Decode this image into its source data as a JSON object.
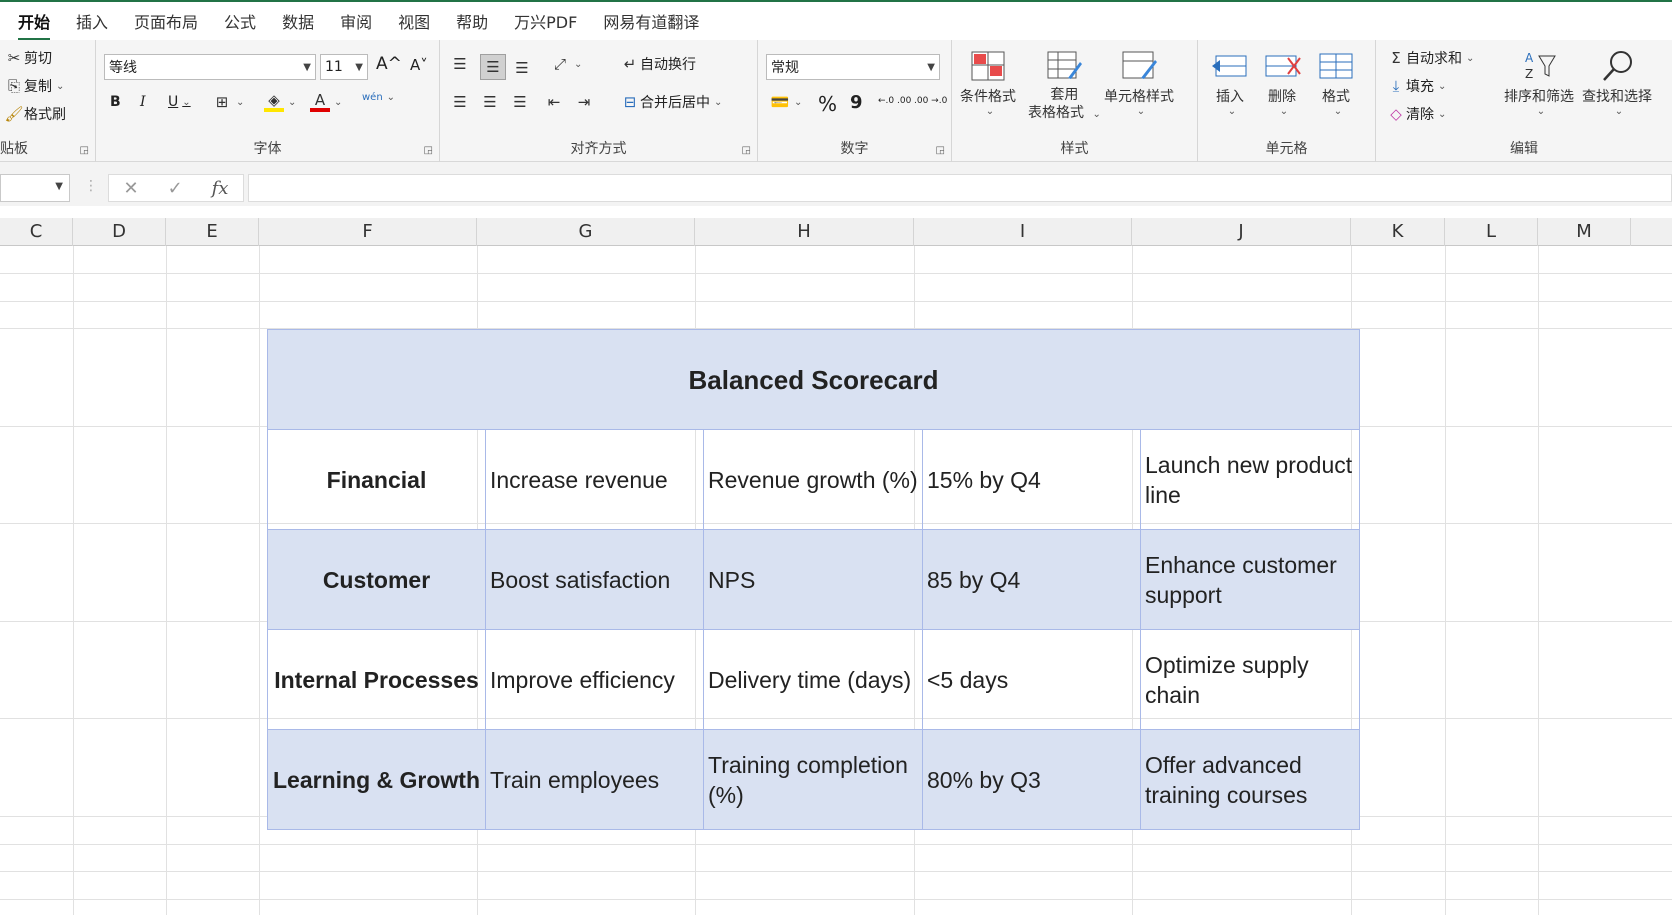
{
  "ribbon_tabs": [
    "开始",
    "插入",
    "页面布局",
    "公式",
    "数据",
    "审阅",
    "视图",
    "帮助",
    "万兴PDF",
    "网易有道翻译"
  ],
  "clipboard": {
    "cut": "剪切",
    "copy": "复制",
    "format_painter": "格式刷",
    "label": "贴板"
  },
  "font": {
    "name": "等线",
    "size": "11",
    "bold": "B",
    "italic": "I",
    "underline": "U",
    "grow": "A^",
    "shrink": "A˅",
    "phonetic": "wén",
    "label": "字体"
  },
  "alignment": {
    "wrap_text": "自动换行",
    "merge_center": "合并后居中",
    "label": "对齐方式"
  },
  "number": {
    "format": "常规",
    "percent": "%",
    "comma": "9",
    "inc_decimal": "←.0 .00",
    "dec_decimal": ".00 →.0",
    "label": "数字"
  },
  "styles": {
    "conditional": "条件格式",
    "table_format_1": "套用",
    "table_format_2": "表格格式",
    "cell_styles": "单元格样式",
    "label": "样式"
  },
  "cells": {
    "insert": "插入",
    "delete": "删除",
    "format": "格式",
    "label": "单元格"
  },
  "editing": {
    "autosum": "自动求和",
    "fill": "填充",
    "clear": "清除",
    "sort_filter": "排序和筛选",
    "find_select": "查找和选择",
    "label": "编辑"
  },
  "formula_bar": {
    "name_box": "",
    "formula": ""
  },
  "columns": [
    "C",
    "D",
    "E",
    "F",
    "G",
    "H",
    "I",
    "J",
    "K",
    "L",
    "M"
  ],
  "scorecard": {
    "title": "Balanced Scorecard",
    "rows": [
      [
        "Financial",
        "Increase revenue",
        "Revenue growth (%)",
        "15% by Q4",
        "Launch new product line"
      ],
      [
        "Customer",
        "Boost satisfaction",
        "NPS",
        "85 by Q4",
        "Enhance customer support"
      ],
      [
        "Internal Processes",
        "Improve efficiency",
        "Delivery time (days)",
        "<5 days",
        "Optimize supply chain"
      ],
      [
        "Learning & Growth",
        "Train employees",
        "Training completion (%)",
        "80% by Q3",
        "Offer advanced training courses"
      ]
    ]
  },
  "colors": {
    "accent": "#217346",
    "header_fill": "#d9e1f2",
    "border": "#a9b9e8"
  }
}
